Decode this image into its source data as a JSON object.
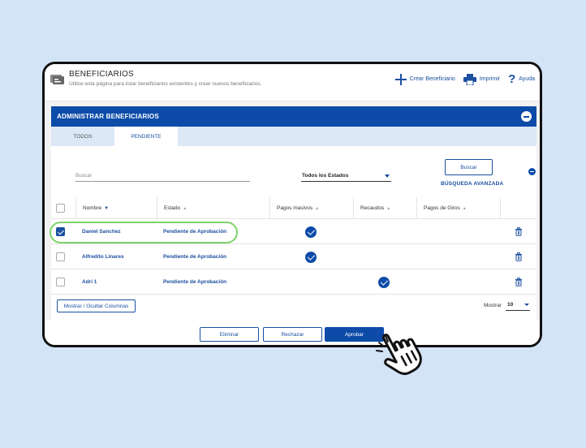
{
  "header": {
    "title": "BENEFICIARIOS",
    "subtitle": "Utilice esta página para listar beneficiarios existentes y crear nuevos beneficiarios.",
    "actions": [
      {
        "label": "Crear Beneficiario",
        "icon": "plus-icon"
      },
      {
        "label": "Imprimir",
        "icon": "printer-icon"
      },
      {
        "label": "Ayuda",
        "icon": "help-icon"
      }
    ]
  },
  "section": {
    "title": "ADMINISTRAR BENEFICIARIOS"
  },
  "tabs": [
    {
      "label": "TODOS",
      "active": false
    },
    {
      "label": "PENDIENTE",
      "active": true
    }
  ],
  "filters": {
    "search_placeholder": "Buscar",
    "status_select": "Todos los Estados",
    "search_button": "Buscar",
    "advanced_search": "BÚSQUEDA AVANZADA"
  },
  "table": {
    "columns": [
      "Nombre",
      "Estado",
      "Pagos masivos",
      "Recaudos",
      "Pagos de Giros"
    ],
    "rows": [
      {
        "name": "Daniel Sanchez",
        "status": "Pendiente de Aprobación",
        "pagos_masivos": true,
        "recaudos": false,
        "checked": true
      },
      {
        "name": "Alfredito Linares",
        "status": "Pendiente de Aprobación",
        "pagos_masivos": true,
        "recaudos": false,
        "checked": false
      },
      {
        "name": "Adri 1",
        "status": "Pendiente de Aprobación",
        "pagos_masivos": false,
        "recaudos": true,
        "checked": false
      }
    ]
  },
  "table_footer": {
    "columns_button": "Mostrar / Ocultar Columnas",
    "show_label": "Mostrar",
    "show_value": "10"
  },
  "buttons": {
    "delete": "Eliminar",
    "reject": "Rechazar",
    "approve": "Aprobar"
  },
  "colors": {
    "accent": "#0d4ba8",
    "highlight": "#7cd36a",
    "background": "#d3e4f7"
  }
}
